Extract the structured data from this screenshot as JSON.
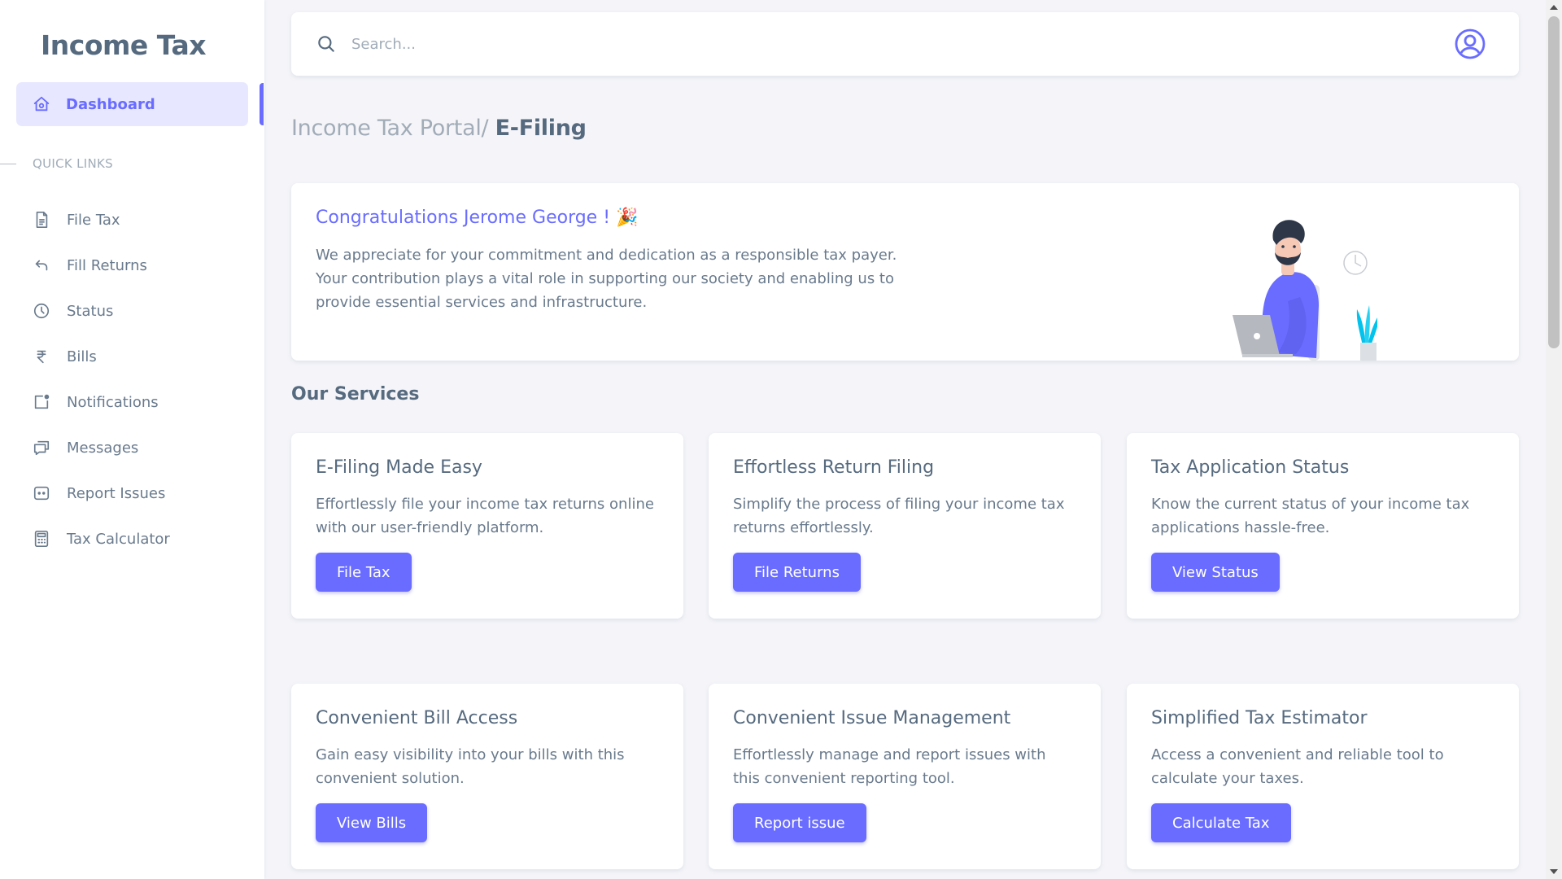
{
  "sidebar": {
    "brand": "Income Tax",
    "active_item": "Dashboard",
    "section_label": "QUICK LINKS",
    "items": [
      {
        "label": "File Tax",
        "icon": "file-icon"
      },
      {
        "label": "Fill Returns",
        "icon": "return-arrow-icon"
      },
      {
        "label": "Status",
        "icon": "clock-icon"
      },
      {
        "label": "Bills",
        "icon": "rupee-icon"
      },
      {
        "label": "Notifications",
        "icon": "notification-icon"
      },
      {
        "label": "Messages",
        "icon": "messages-icon"
      },
      {
        "label": "Report Issues",
        "icon": "report-icon"
      },
      {
        "label": "Tax Calculator",
        "icon": "calculator-icon"
      }
    ]
  },
  "header": {
    "search_placeholder": "Search..."
  },
  "breadcrumb": {
    "parent": "Income Tax Portal/",
    "current": "E-Filing"
  },
  "welcome": {
    "title": "Congratulations Jerome George ! 🎉",
    "line1": "We appreciate for your commitment and dedication as a responsible tax payer.",
    "line2": "Your contribution plays a vital role in supporting our society and enabling us to provide essential services and infrastructure."
  },
  "services": {
    "title": "Our Services",
    "cards": [
      {
        "title": "E-Filing Made Easy",
        "desc": "Effortlessly file your income tax returns online with our user-friendly platform.",
        "button": "File Tax"
      },
      {
        "title": "Effortless Return Filing",
        "desc": "Simplify the process of filing your income tax returns effortlessly.",
        "button": "File Returns"
      },
      {
        "title": "Tax Application Status",
        "desc": "Know the current status of your income tax applications hassle-free.",
        "button": "View Status"
      },
      {
        "title": "Convenient Bill Access",
        "desc": "Gain easy visibility into your bills with this convenient solution.",
        "button": "View Bills"
      },
      {
        "title": "Convenient Issue Management",
        "desc": "Effortlessly manage and report issues with this convenient reporting tool.",
        "button": "Report issue"
      },
      {
        "title": "Simplified Tax Estimator",
        "desc": "Access a convenient and reliable tool to calculate your taxes.",
        "button": "Calculate Tax"
      }
    ]
  },
  "colors": {
    "accent": "#696cff",
    "accent_light": "#e7e7ff",
    "text": "#566a7f",
    "muted": "#a1acb8",
    "background": "#f5f5f9"
  }
}
